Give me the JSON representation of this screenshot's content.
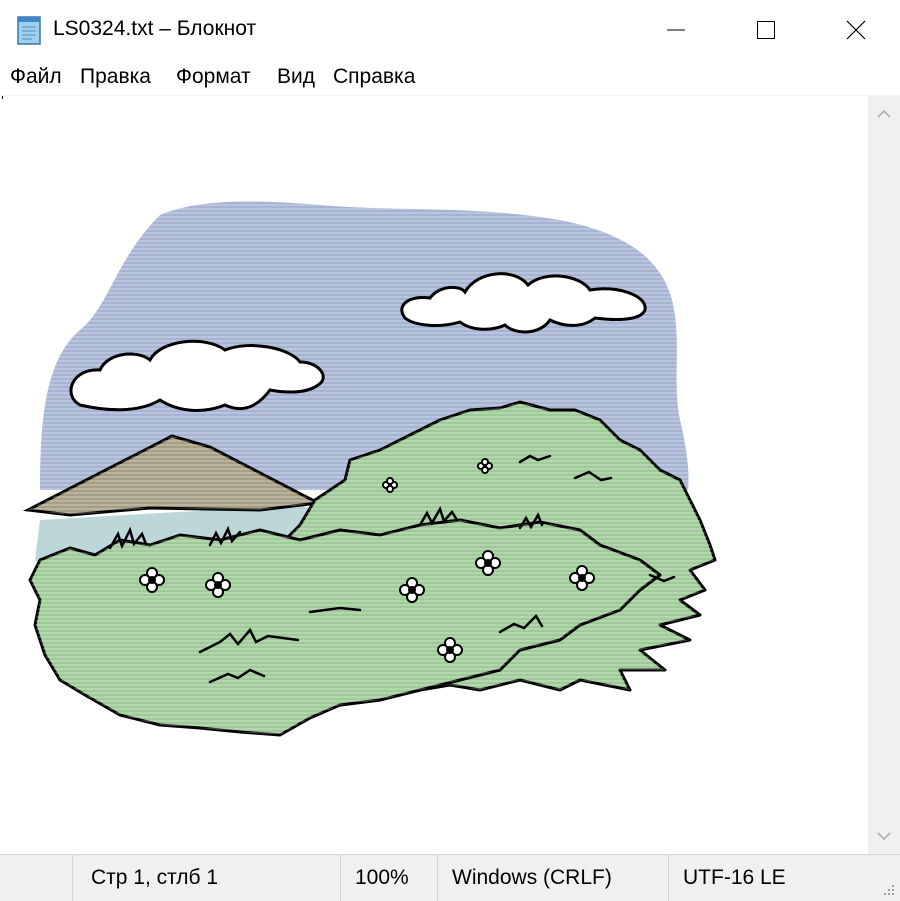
{
  "window": {
    "title": "LS0324.txt – Блокнот",
    "icon": "notepad-icon"
  },
  "controls": {
    "minimize": "minimize-icon",
    "maximize": "maximize-icon",
    "close": "close-icon"
  },
  "menu": {
    "items": [
      "Файл",
      "Правка",
      "Формат",
      "Вид",
      "Справка"
    ]
  },
  "editor": {
    "content_image": "landscape-illustration",
    "colors": {
      "sky": "#a6b4d4",
      "cloud": "#ffffff",
      "mountain": "#a69d83",
      "water": "#bcd6da",
      "grass": "#9dca97",
      "outline": "#000000"
    }
  },
  "status": {
    "position": "Стр 1, стлб 1",
    "zoom": "100%",
    "line_ending": "Windows (CRLF)",
    "encoding": "UTF-16 LE"
  }
}
